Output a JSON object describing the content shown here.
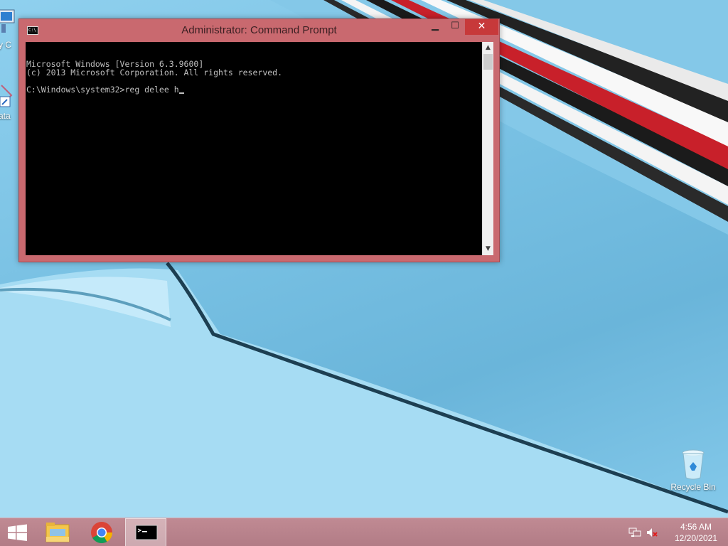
{
  "window": {
    "title": "Administrator: Command Prompt",
    "minimize_label": "▁",
    "maximize_label": "☐",
    "close_label": "✕",
    "app_icon_label": "C:\\",
    "console_lines": [
      "Microsoft Windows [Version 6.3.9600]",
      "(c) 2013 Microsoft Corporation. All rights reserved.",
      "",
      "C:\\Windows\\system32>reg delee h"
    ]
  },
  "desktop": {
    "icons": [
      {
        "label": "My C",
        "icon": "computer-icon"
      },
      {
        "label": "Data",
        "icon": "shortcut-icon"
      },
      {
        "label": "Recycle Bin",
        "icon": "recycle-bin-icon"
      }
    ]
  },
  "taskbar": {
    "items": [
      {
        "name": "start",
        "icon": "windows-logo-icon"
      },
      {
        "name": "file-explorer",
        "icon": "folder-icon"
      },
      {
        "name": "chrome",
        "icon": "chrome-icon"
      },
      {
        "name": "command-prompt",
        "icon": "cmd-icon",
        "active": true
      }
    ],
    "clock": {
      "time": "4:56 AM",
      "date": "12/20/2021"
    },
    "tray": [
      "network-icon",
      "volume-muted-icon"
    ]
  },
  "colors": {
    "window_frame": "#c9696f",
    "close_button": "#c7393a",
    "console_bg": "#000000",
    "console_text": "#c0c0c0",
    "taskbar": "#b8828c"
  }
}
